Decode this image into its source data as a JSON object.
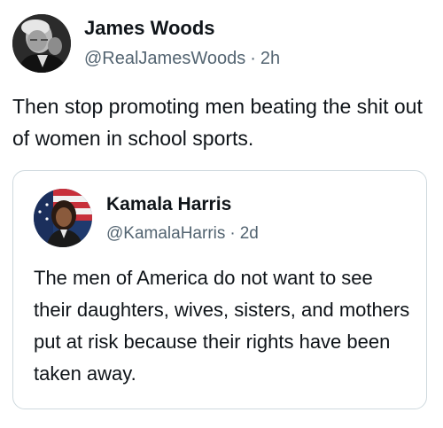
{
  "tweet": {
    "author": {
      "name": "James Woods",
      "handle": "@RealJamesWoods",
      "separator": "·",
      "time": "2h"
    },
    "text": "Then stop promoting men beating the shit out of women in school sports."
  },
  "quoted_tweet": {
    "author": {
      "name": "Kamala Harris",
      "handle": "@KamalaHarris",
      "separator": "·",
      "time": "2d"
    },
    "text": "The men of America do not want to see their daughters, wives, sisters, and mothers put at risk because their rights have been taken away."
  },
  "colors": {
    "text_primary": "#0f1419",
    "text_secondary": "#536471",
    "card_border": "#cfd9de"
  }
}
